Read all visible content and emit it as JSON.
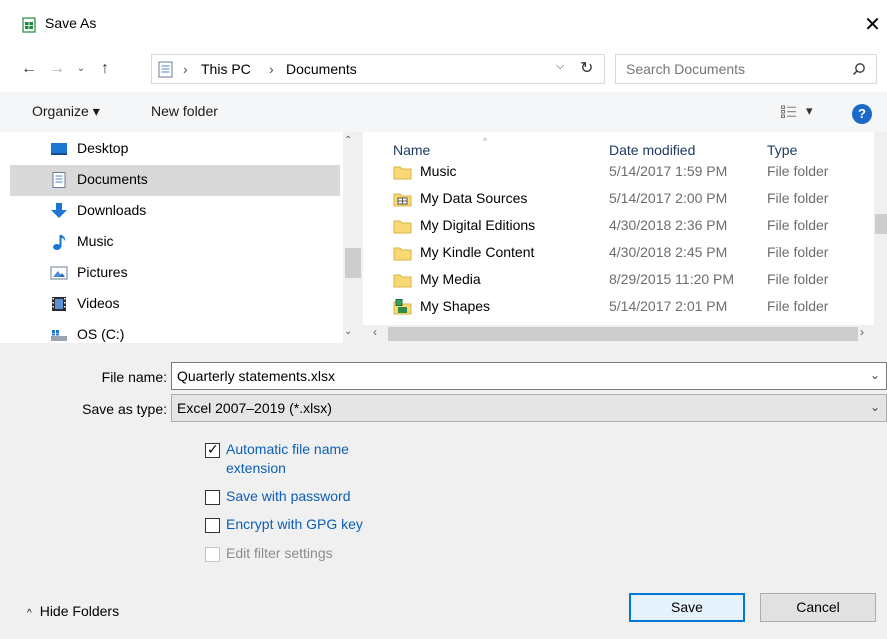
{
  "window": {
    "title": "Save As",
    "close_glyph": "✕"
  },
  "address": {
    "back_glyph": "←",
    "forward_glyph": "→",
    "recent_glyph": "⌄",
    "up_glyph": "↑",
    "separator": "›",
    "crumbs": [
      "This PC",
      "Documents"
    ],
    "dropdown_glyph": "⌵",
    "refresh_glyph": "↻"
  },
  "search": {
    "placeholder": "Search Documents"
  },
  "toolbar": {
    "organize_label": "Organize ▾",
    "new_folder_label": "New folder",
    "view_glyph": "▾",
    "help_glyph": "?"
  },
  "nav": {
    "items": [
      {
        "label": "Desktop",
        "icon": "desktop-icon"
      },
      {
        "label": "Documents",
        "icon": "documents-icon",
        "selected": true
      },
      {
        "label": "Downloads",
        "icon": "downloads-icon"
      },
      {
        "label": "Music",
        "icon": "music-icon"
      },
      {
        "label": "Pictures",
        "icon": "pictures-icon"
      },
      {
        "label": "Videos",
        "icon": "videos-icon"
      },
      {
        "label": "OS (C:)",
        "icon": "drive-icon"
      }
    ],
    "scroll_up": "⌃",
    "scroll_down": "⌄"
  },
  "files": {
    "columns": {
      "name": "Name",
      "date": "Date modified",
      "type": "Type"
    },
    "sort_glyph": "^",
    "rows": [
      {
        "name": "Music",
        "date": "5/14/2017 1:59 PM",
        "type": "File folder",
        "icon": "folder-icon"
      },
      {
        "name": "My Data Sources",
        "date": "5/14/2017 2:00 PM",
        "type": "File folder",
        "icon": "data-sources-folder-icon"
      },
      {
        "name": "My Digital Editions",
        "date": "4/30/2018 2:36 PM",
        "type": "File folder",
        "icon": "folder-icon"
      },
      {
        "name": "My Kindle Content",
        "date": "4/30/2018 2:45 PM",
        "type": "File folder",
        "icon": "folder-icon"
      },
      {
        "name": "My Media",
        "date": "8/29/2015 11:20 PM",
        "type": "File folder",
        "icon": "folder-icon"
      },
      {
        "name": "My Shapes",
        "date": "5/14/2017 2:01 PM",
        "type": "File folder",
        "icon": "shapes-folder-icon"
      }
    ],
    "hscroll_left": "‹",
    "hscroll_right": "›"
  },
  "form": {
    "file_name_label": "File name:",
    "file_name_value": "Quarterly statements.xlsx",
    "save_type_label": "Save as type:",
    "save_type_value": "Excel 2007–2019  (*.xlsx)",
    "dropdown_glyph": "⌄"
  },
  "options": {
    "auto_ext": {
      "label": "Automatic file name extension",
      "checked": true
    },
    "password": {
      "label": "Save with password",
      "checked": false
    },
    "gpg": {
      "label": "Encrypt with GPG key",
      "checked": false
    },
    "filter": {
      "label": "Edit filter settings",
      "checked": false,
      "disabled": true
    }
  },
  "footer": {
    "hide_folders_glyph": "^",
    "hide_folders_label": "Hide Folders",
    "save_label": "Save",
    "cancel_label": "Cancel"
  },
  "colors": {
    "accent": "#0078d7",
    "selected_bg": "#d9d9d9",
    "link": "#0a5fb4",
    "folder": "#f8d775"
  }
}
